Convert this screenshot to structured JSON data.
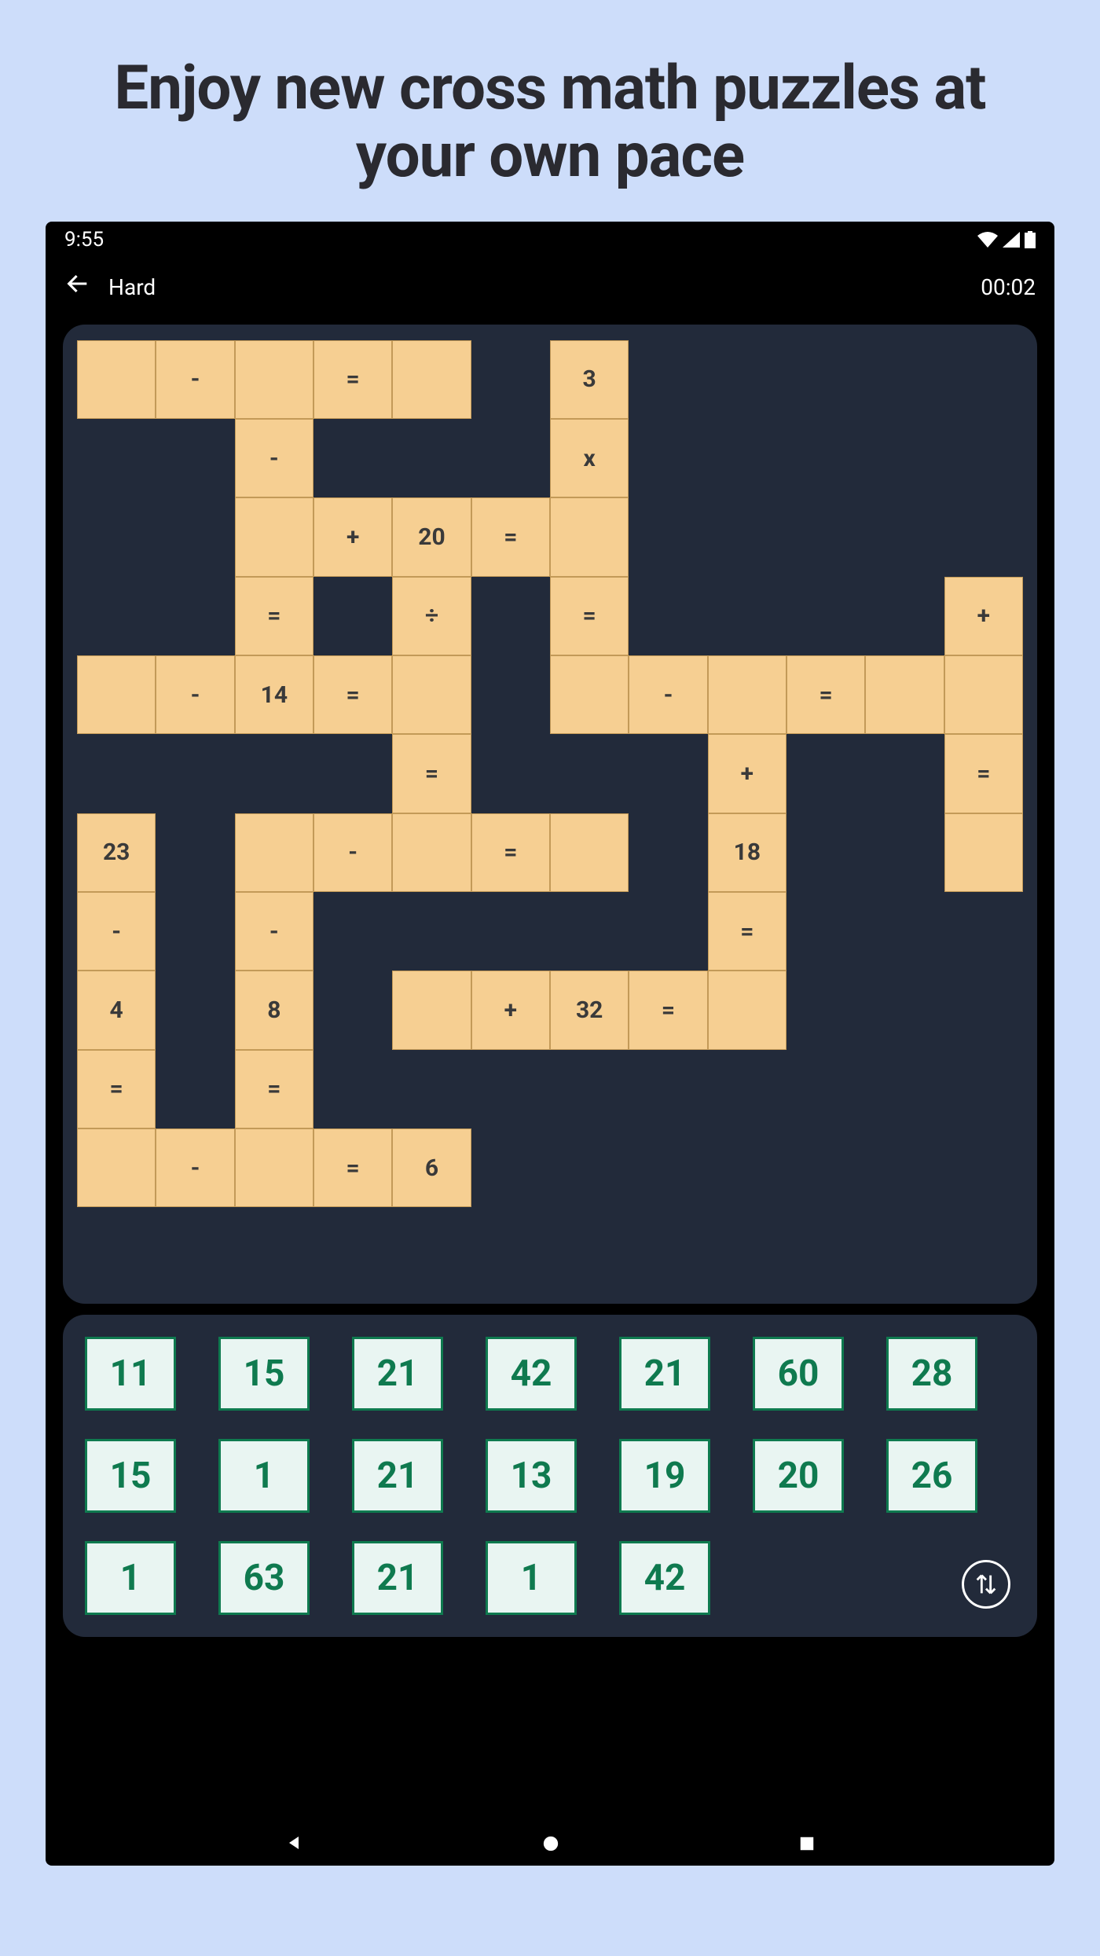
{
  "headline": "Enjoy new cross math puzzles at your own pace",
  "statusbar": {
    "time": "9:55"
  },
  "topbar": {
    "difficulty": "Hard",
    "timer": "00:02"
  },
  "grid": {
    "rows": 12,
    "cols": 12,
    "cells": [
      {
        "r": 0,
        "c": 0,
        "v": ""
      },
      {
        "r": 0,
        "c": 1,
        "v": "-"
      },
      {
        "r": 0,
        "c": 2,
        "v": ""
      },
      {
        "r": 0,
        "c": 3,
        "v": "="
      },
      {
        "r": 0,
        "c": 4,
        "v": ""
      },
      {
        "r": 0,
        "c": 6,
        "v": "3"
      },
      {
        "r": 1,
        "c": 2,
        "v": "-"
      },
      {
        "r": 1,
        "c": 6,
        "v": "x"
      },
      {
        "r": 2,
        "c": 2,
        "v": ""
      },
      {
        "r": 2,
        "c": 3,
        "v": "+"
      },
      {
        "r": 2,
        "c": 4,
        "v": "20"
      },
      {
        "r": 2,
        "c": 5,
        "v": "="
      },
      {
        "r": 2,
        "c": 6,
        "v": ""
      },
      {
        "r": 3,
        "c": 2,
        "v": "="
      },
      {
        "r": 3,
        "c": 4,
        "v": "÷"
      },
      {
        "r": 3,
        "c": 6,
        "v": "="
      },
      {
        "r": 3,
        "c": 11,
        "v": "+"
      },
      {
        "r": 4,
        "c": 0,
        "v": ""
      },
      {
        "r": 4,
        "c": 1,
        "v": "-"
      },
      {
        "r": 4,
        "c": 2,
        "v": "14"
      },
      {
        "r": 4,
        "c": 3,
        "v": "="
      },
      {
        "r": 4,
        "c": 4,
        "v": ""
      },
      {
        "r": 4,
        "c": 6,
        "v": ""
      },
      {
        "r": 4,
        "c": 7,
        "v": "-"
      },
      {
        "r": 4,
        "c": 8,
        "v": ""
      },
      {
        "r": 4,
        "c": 9,
        "v": "="
      },
      {
        "r": 4,
        "c": 10,
        "v": ""
      },
      {
        "r": 4,
        "c": 11,
        "v": ""
      },
      {
        "r": 5,
        "c": 4,
        "v": "="
      },
      {
        "r": 5,
        "c": 8,
        "v": "+"
      },
      {
        "r": 5,
        "c": 11,
        "v": "="
      },
      {
        "r": 6,
        "c": 0,
        "v": "23"
      },
      {
        "r": 6,
        "c": 2,
        "v": ""
      },
      {
        "r": 6,
        "c": 3,
        "v": "-"
      },
      {
        "r": 6,
        "c": 4,
        "v": ""
      },
      {
        "r": 6,
        "c": 5,
        "v": "="
      },
      {
        "r": 6,
        "c": 6,
        "v": ""
      },
      {
        "r": 6,
        "c": 8,
        "v": "18"
      },
      {
        "r": 6,
        "c": 11,
        "v": ""
      },
      {
        "r": 7,
        "c": 0,
        "v": "-"
      },
      {
        "r": 7,
        "c": 2,
        "v": "-"
      },
      {
        "r": 7,
        "c": 8,
        "v": "="
      },
      {
        "r": 8,
        "c": 0,
        "v": "4"
      },
      {
        "r": 8,
        "c": 2,
        "v": "8"
      },
      {
        "r": 8,
        "c": 4,
        "v": ""
      },
      {
        "r": 8,
        "c": 5,
        "v": "+"
      },
      {
        "r": 8,
        "c": 6,
        "v": "32"
      },
      {
        "r": 8,
        "c": 7,
        "v": "="
      },
      {
        "r": 8,
        "c": 8,
        "v": ""
      },
      {
        "r": 9,
        "c": 0,
        "v": "="
      },
      {
        "r": 9,
        "c": 2,
        "v": "="
      },
      {
        "r": 10,
        "c": 0,
        "v": ""
      },
      {
        "r": 10,
        "c": 1,
        "v": "-"
      },
      {
        "r": 10,
        "c": 2,
        "v": ""
      },
      {
        "r": 10,
        "c": 3,
        "v": "="
      },
      {
        "r": 10,
        "c": 4,
        "v": "6"
      }
    ]
  },
  "tiles": [
    [
      "11",
      "15",
      "21",
      "42",
      "21",
      "60",
      "28"
    ],
    [
      "15",
      "1",
      "21",
      "13",
      "19",
      "20",
      "26"
    ],
    [
      "1",
      "63",
      "21",
      "1",
      "42"
    ]
  ]
}
